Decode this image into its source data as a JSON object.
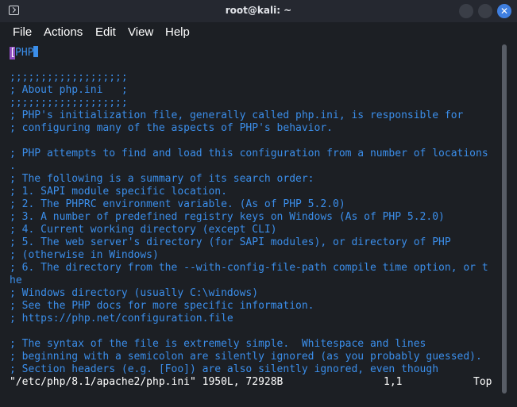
{
  "window": {
    "title": "root@kali: ~",
    "close_glyph": "✕"
  },
  "menu": {
    "file": "File",
    "actions": "Actions",
    "edit": "Edit",
    "view": "View",
    "help": "Help"
  },
  "editor": {
    "cursor_char": "[",
    "first_line_rest": "PHP",
    "lines": [
      "",
      ";;;;;;;;;;;;;;;;;;;",
      "; About php.ini   ;",
      ";;;;;;;;;;;;;;;;;;;",
      "; PHP's initialization file, generally called php.ini, is responsible for",
      "; configuring many of the aspects of PHP's behavior.",
      "",
      "; PHP attempts to find and load this configuration from a number of locations",
      ".",
      "; The following is a summary of its search order:",
      "; 1. SAPI module specific location.",
      "; 2. The PHPRC environment variable. (As of PHP 5.2.0)",
      "; 3. A number of predefined registry keys on Windows (As of PHP 5.2.0)",
      "; 4. Current working directory (except CLI)",
      "; 5. The web server's directory (for SAPI modules), or directory of PHP",
      "; (otherwise in Windows)",
      "; 6. The directory from the --with-config-file-path compile time option, or t",
      "he",
      "; Windows directory (usually C:\\windows)",
      "; See the PHP docs for more specific information.",
      "; https://php.net/configuration.file",
      "",
      "; The syntax of the file is extremely simple.  Whitespace and lines",
      "; beginning with a semicolon are silently ignored (as you probably guessed).",
      "; Section headers (e.g. [Foo]) are also silently ignored, even though"
    ],
    "status": {
      "file_info": "\"/etc/php/8.1/apache2/php.ini\" 1950L, 72928B",
      "position": "1,1",
      "scroll": "Top"
    }
  },
  "colors": {
    "background": "#1c1f24",
    "text": "#3b8eea",
    "cursor": "#8f4fc0",
    "close_button": "#3f7fe0"
  }
}
